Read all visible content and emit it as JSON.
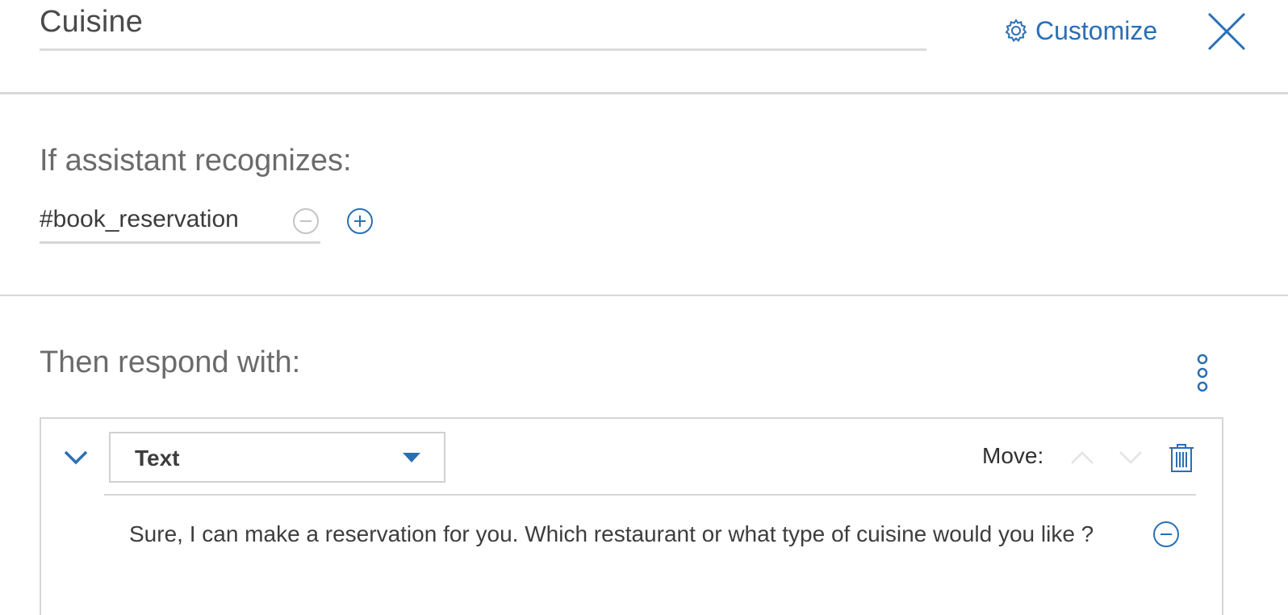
{
  "node": {
    "name": "Cuisine"
  },
  "header": {
    "customize_label": "Customize"
  },
  "conditions": {
    "heading": "If assistant recognizes:",
    "items": [
      {
        "value": "#book_reservation"
      }
    ]
  },
  "responses": {
    "heading": "Then respond with:",
    "cards": [
      {
        "type": "Text",
        "move_label": "Move:",
        "variations": [
          {
            "text": "Sure, I can make a reservation for you. Which restaurant or what type of cuisine would you like ?"
          }
        ]
      }
    ]
  },
  "colors": {
    "accent": "#2a6fb5",
    "muted_icon": "#c4c4c4",
    "border": "#d6d6d6"
  },
  "icons": [
    "gear-icon",
    "close-icon",
    "minus-circle-icon",
    "plus-circle-icon",
    "kebab-menu-icon",
    "chevron-down-icon",
    "caret-down-icon",
    "chevron-up-icon",
    "trash-icon"
  ]
}
